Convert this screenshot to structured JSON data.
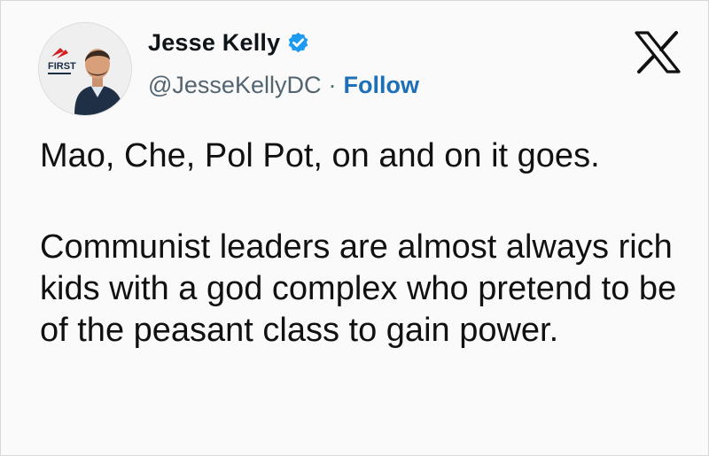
{
  "tweet": {
    "author_name": "Jesse Kelly",
    "handle": "@JesseKellyDC",
    "separator": "·",
    "follow_label": "Follow",
    "paragraphs": [
      "Mao, Che, Pol Pot, on and on it goes.",
      "Communist leaders are almost always rich kids with a god complex who pretend to be of the peasant class to gain power."
    ]
  },
  "avatar": {
    "logo_text": "FIRST"
  },
  "icons": {
    "verified": "verified-badge-icon",
    "brand": "x-logo-icon"
  },
  "colors": {
    "verified": "#1d9bf0",
    "follow": "#1d6fb8",
    "handle": "#536471",
    "logo_red": "#d32020"
  }
}
